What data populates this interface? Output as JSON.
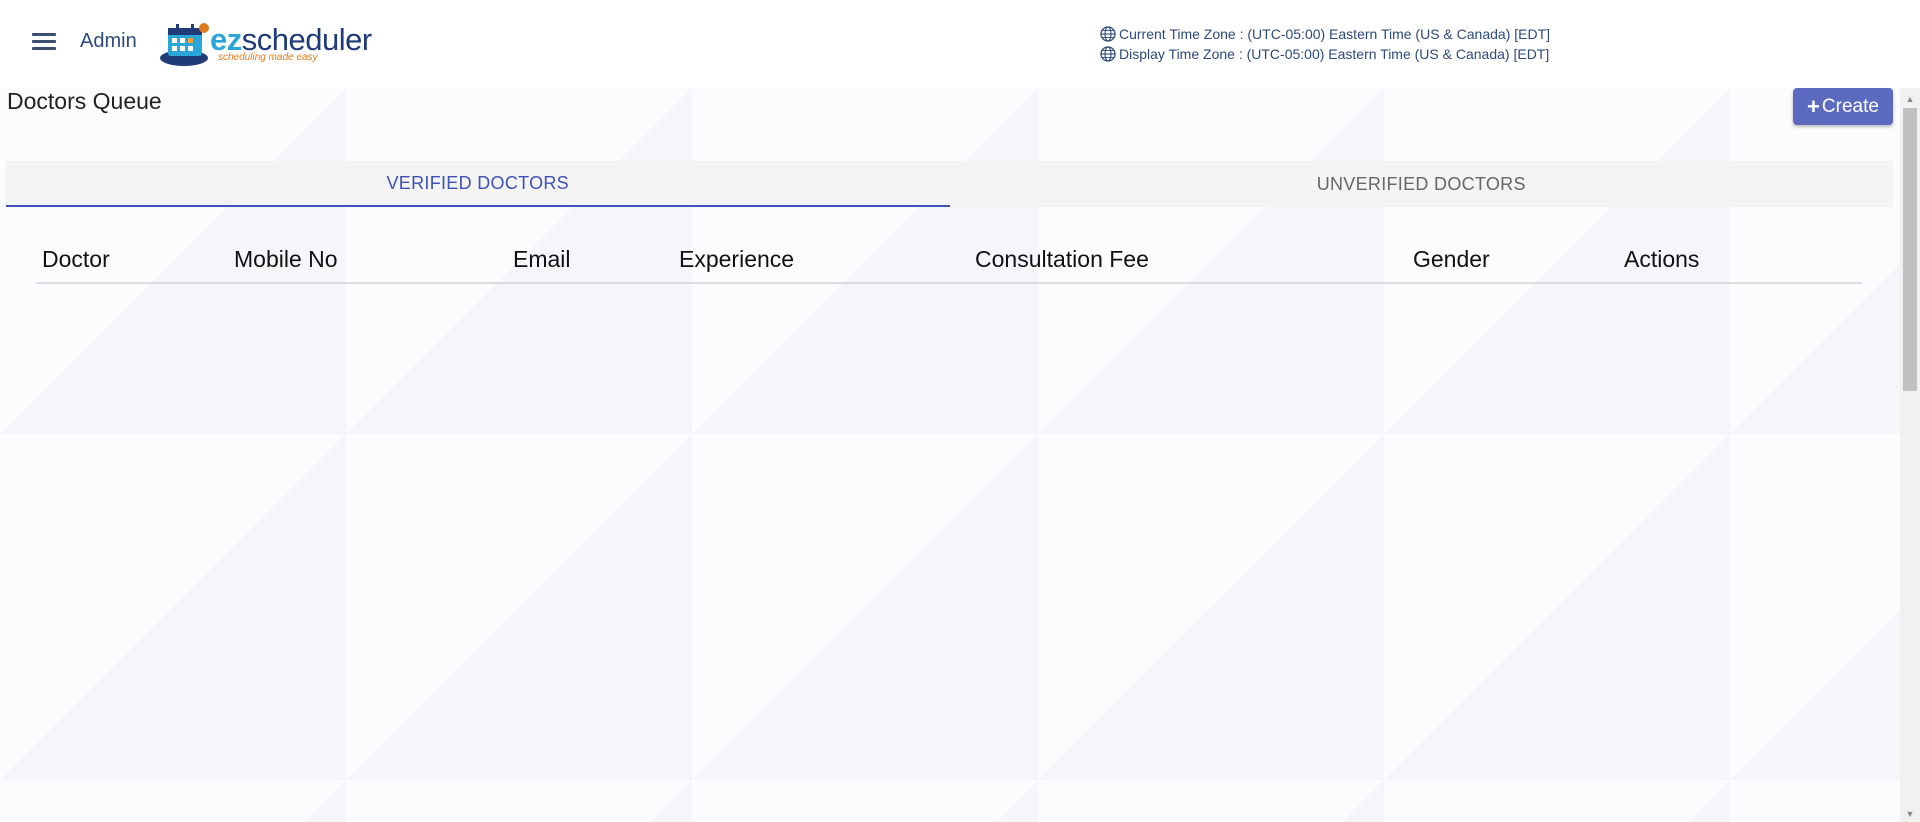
{
  "header": {
    "menu_icon": "hamburger-menu-icon",
    "role_label": "Admin",
    "logo": {
      "brand_prefix": "ez",
      "brand_suffix": "scheduler",
      "tagline": "scheduling made easy"
    },
    "timezones": {
      "icon": "globe-icon",
      "current": "Current Time Zone : (UTC-05:00) Eastern Time (US & Canada) [EDT]",
      "display": "Display Time Zone : (UTC-05:00) Eastern Time (US & Canada) [EDT]"
    }
  },
  "main": {
    "title": "Doctors Queue",
    "create_button": {
      "icon": "plus",
      "label": "Create"
    },
    "tabs": [
      {
        "label": "VERIFIED DOCTORS",
        "active": true
      },
      {
        "label": "UNVERIFIED DOCTORS",
        "active": false
      }
    ],
    "table": {
      "columns": [
        "Doctor",
        "Mobile No",
        "Email",
        "Experience",
        "Consultation Fee",
        "Gender",
        "Actions"
      ],
      "rows": []
    }
  },
  "colors": {
    "accent": "#3f51b5",
    "button": "#5c6bc0",
    "header_text": "#2c4a7a"
  }
}
